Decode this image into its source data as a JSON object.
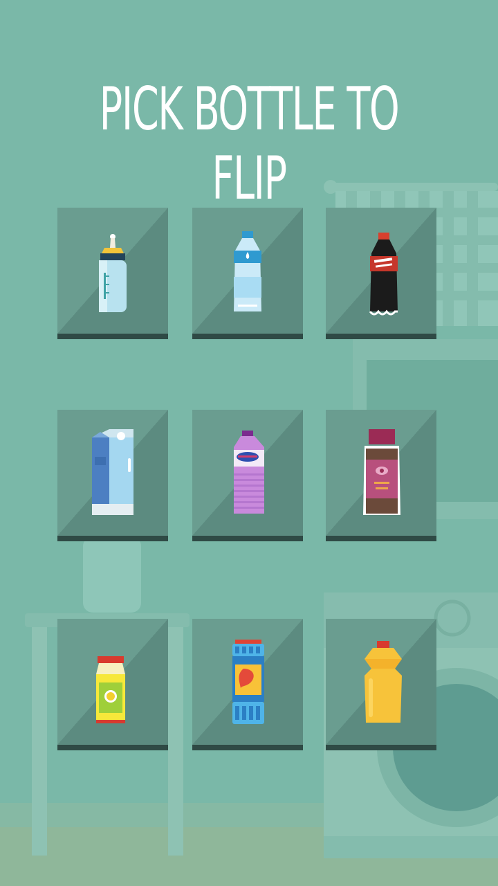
{
  "title": "PICK BOTTLE TO FLIP",
  "colors": {
    "background": "#7ab8a8",
    "tile": "#6a9d90",
    "tile_shadow": "#5c8b80",
    "tile_base": "#2f4a45",
    "title_text": "#ffffff"
  },
  "bottles": [
    {
      "name": "baby-bottle-icon"
    },
    {
      "name": "water-bottle-icon"
    },
    {
      "name": "cola-bottle-icon"
    },
    {
      "name": "milk-carton-icon"
    },
    {
      "name": "purple-bottle-icon"
    },
    {
      "name": "jar-bottle-icon"
    },
    {
      "name": "juice-bottle-icon"
    },
    {
      "name": "blue-container-icon"
    },
    {
      "name": "yellow-detergent-icon"
    }
  ]
}
